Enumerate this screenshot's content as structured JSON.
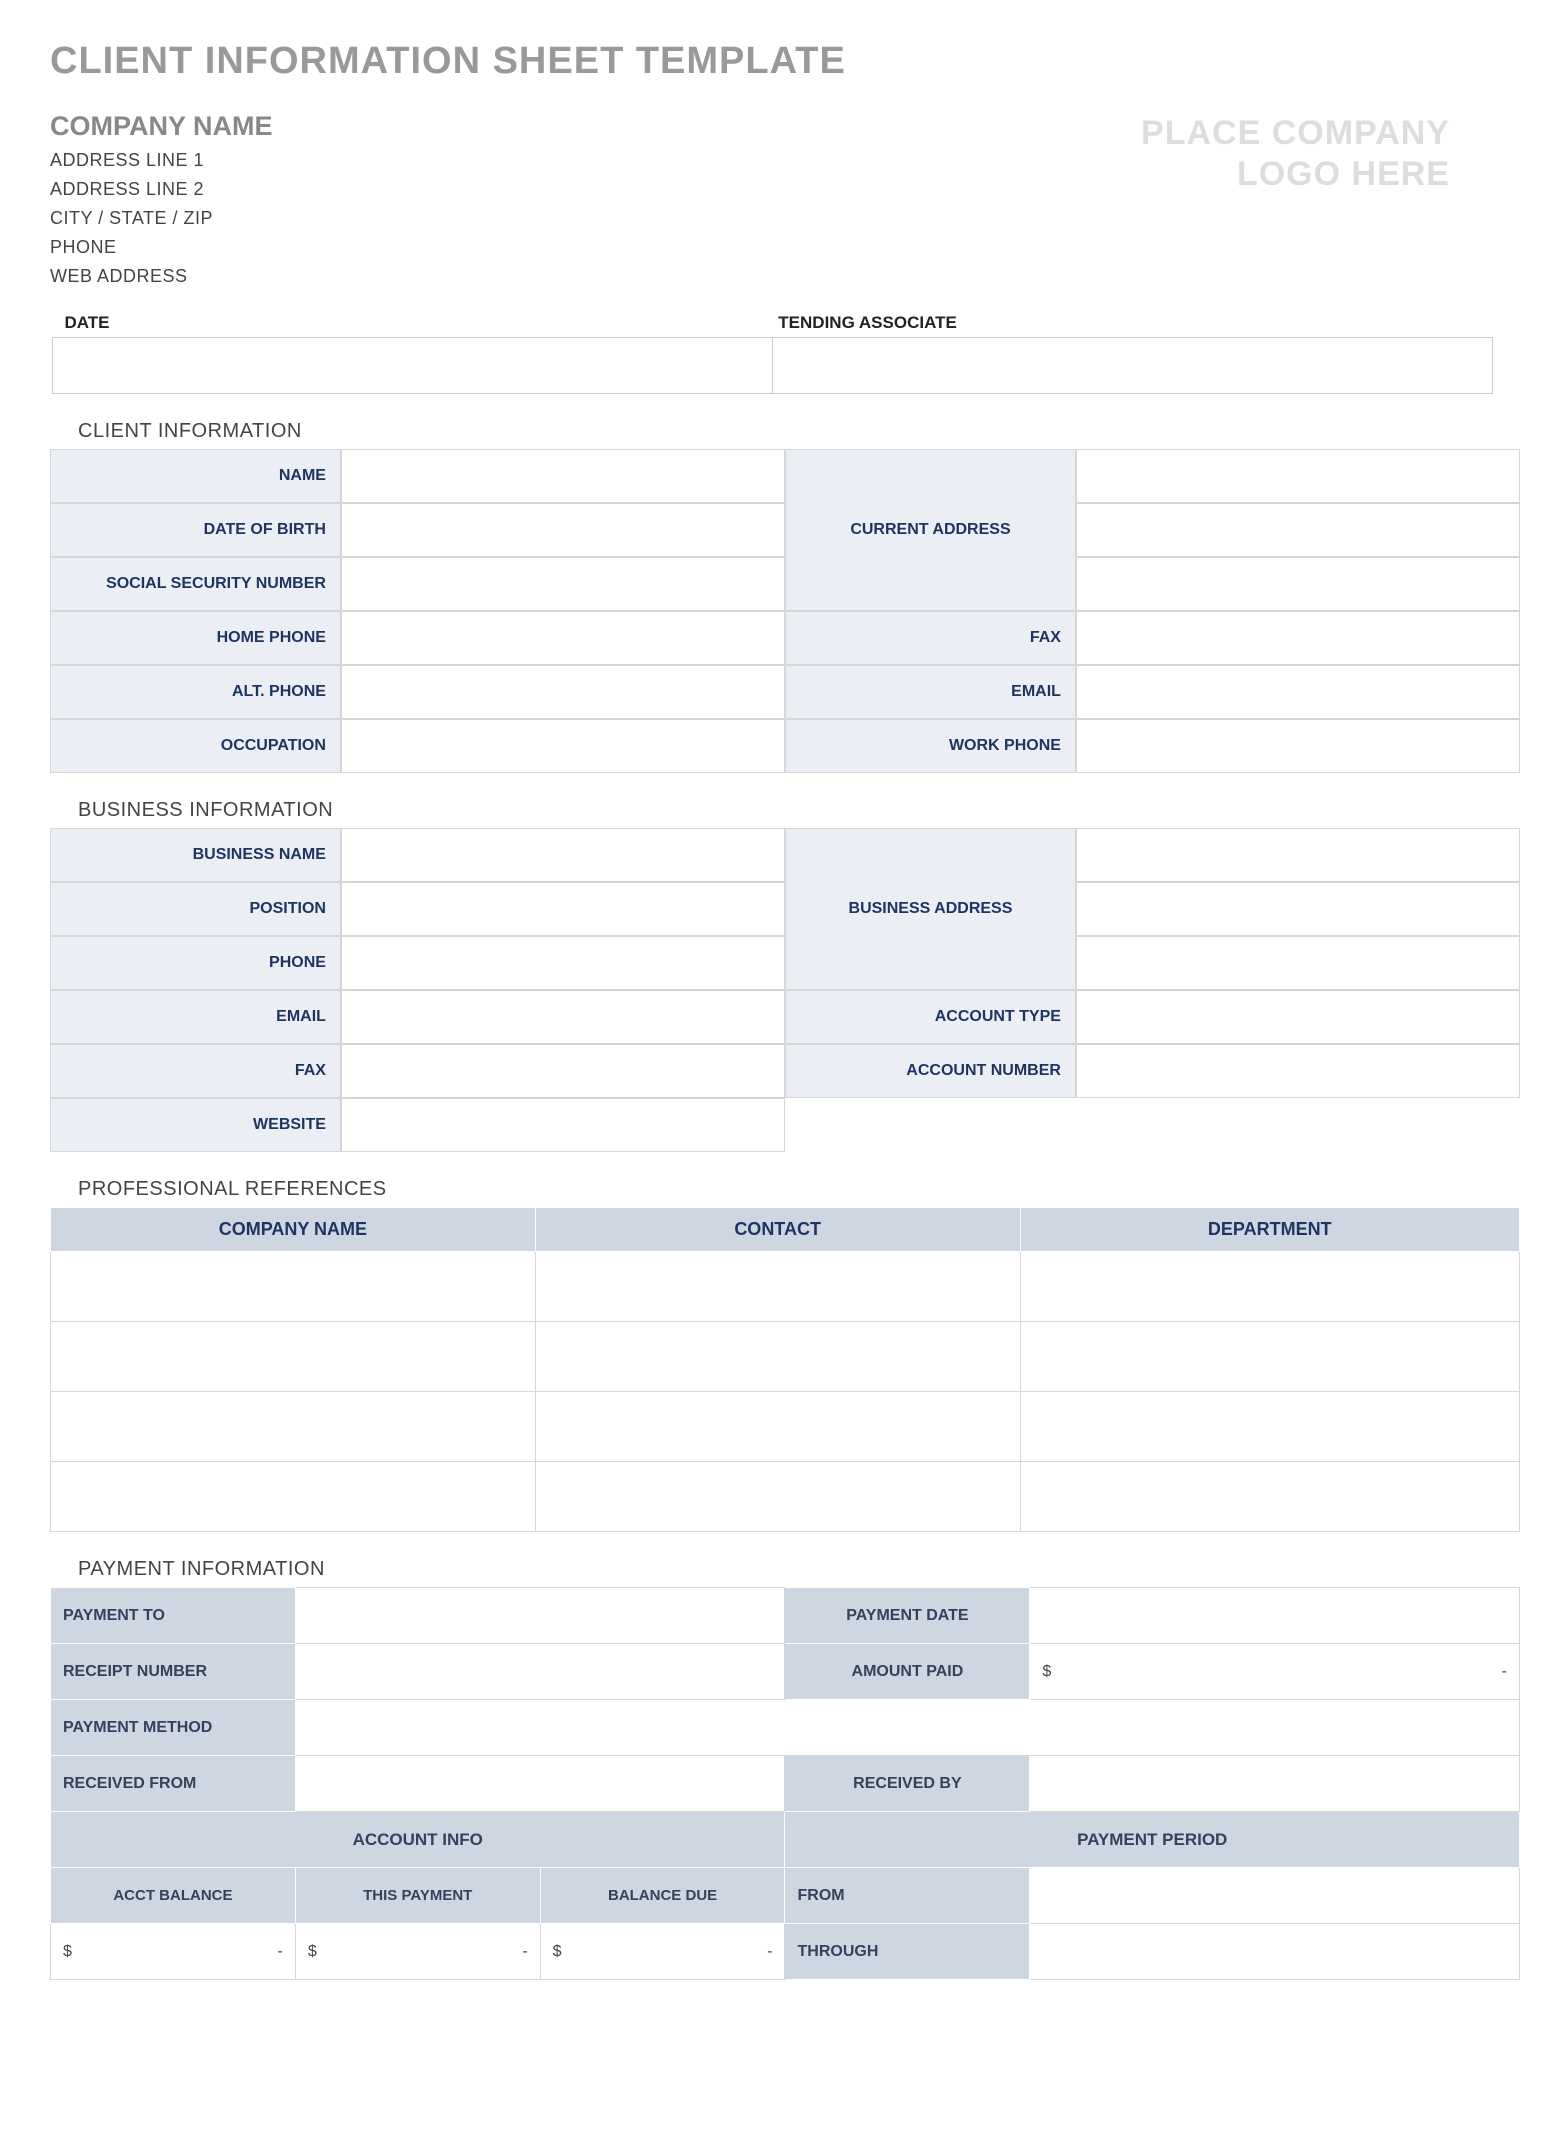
{
  "page_title": "CLIENT INFORMATION SHEET TEMPLATE",
  "company": {
    "name_label": "COMPANY NAME",
    "lines": [
      "ADDRESS LINE 1",
      "ADDRESS LINE 2",
      "CITY / STATE / ZIP",
      "PHONE",
      "WEB ADDRESS"
    ],
    "logo_text_1": "PLACE COMPANY",
    "logo_text_2": "LOGO HERE"
  },
  "meta": {
    "date_label": "DATE",
    "tending_label": "TENDING ASSOCIATE",
    "date_value": "",
    "tending_value": ""
  },
  "sections": {
    "client": "CLIENT INFORMATION",
    "business": "BUSINESS INFORMATION",
    "refs": "PROFESSIONAL REFERENCES",
    "payment": "PAYMENT INFORMATION"
  },
  "client": {
    "name": "NAME",
    "dob": "DATE OF BIRTH",
    "ssn": "SOCIAL SECURITY NUMBER",
    "home_phone": "HOME PHONE",
    "alt_phone": "ALT. PHONE",
    "occupation": "OCCUPATION",
    "current_address": "CURRENT ADDRESS",
    "fax": "FAX",
    "email": "EMAIL",
    "work_phone": "WORK PHONE"
  },
  "business": {
    "bname": "BUSINESS NAME",
    "position": "POSITION",
    "phone": "PHONE",
    "email": "EMAIL",
    "fax": "FAX",
    "website": "WEBSITE",
    "baddress": "BUSINESS ADDRESS",
    "acct_type": "ACCOUNT TYPE",
    "acct_num": "ACCOUNT NUMBER"
  },
  "refs": {
    "col_company": "COMPANY NAME",
    "col_contact": "CONTACT",
    "col_dept": "DEPARTMENT"
  },
  "payment": {
    "payment_to": "PAYMENT TO",
    "receipt_num": "RECEIPT NUMBER",
    "payment_method": "PAYMENT METHOD",
    "received_from": "RECEIVED FROM",
    "payment_date": "PAYMENT DATE",
    "amount_paid": "AMOUNT PAID",
    "received_by": "RECEIVED BY",
    "account_info": "ACCOUNT INFO",
    "payment_period": "PAYMENT PERIOD",
    "acct_balance": "ACCT BALANCE",
    "this_payment": "THIS PAYMENT",
    "balance_due": "BALANCE DUE",
    "from": "FROM",
    "through": "THROUGH",
    "dollar": "$",
    "dash": "-"
  }
}
